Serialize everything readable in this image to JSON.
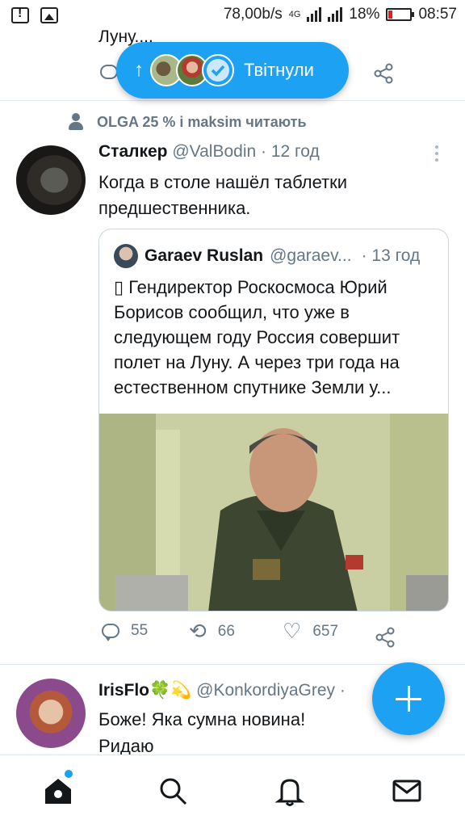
{
  "status_bar": {
    "speed": "78,00b/s",
    "network": "4G",
    "battery": "18%",
    "time": "08:57"
  },
  "previous_tweet": {
    "text_fragment": "Луну...."
  },
  "new_tweets_pill": {
    "label": "Твітнули"
  },
  "social_context": {
    "text": "OLGA 25 % і maksim читають"
  },
  "tweet": {
    "author": "Сталкер",
    "handle": "@ValBodin",
    "time": "· 12 год",
    "text": "Когда в столе нашёл таблетки предшественника.",
    "quote": {
      "author": "Garaev Ruslan",
      "handle": "@garaev...",
      "time": "· 13 год",
      "text": "▯ Гендиректор Роскосмоса Юрий Борисов сообщил, что уже в следующем году Россия совершит полет на Луну. А через три года на естественном спутнике Земли у..."
    },
    "stats": {
      "replies": "55",
      "retweets": "66",
      "likes": "657"
    }
  },
  "next_tweet": {
    "author": "IrisFlo🍀💫",
    "handle": "@KonkordiyaGrey",
    "time": "·",
    "text": "Боже! Яка сумна новина! Ридаю"
  },
  "accent_color": "#1da1f2",
  "nav": {
    "items": [
      "home-icon",
      "search-icon",
      "bell-icon",
      "mail-icon"
    ]
  }
}
